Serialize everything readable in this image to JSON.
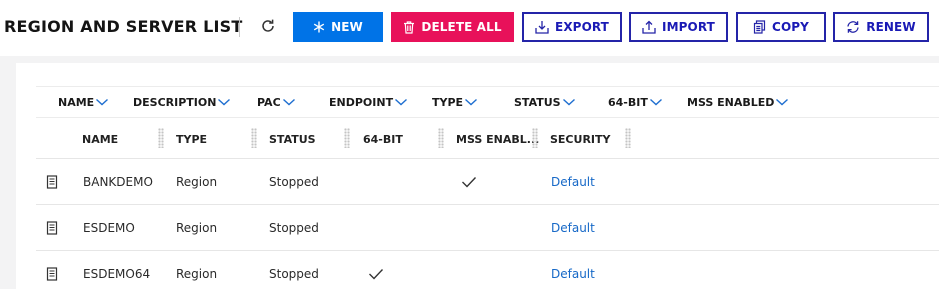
{
  "header": {
    "title": "REGION AND SERVER LIST",
    "buttons": {
      "new": "NEW",
      "delete_all": "DELETE ALL",
      "export": "EXPORT",
      "import": "IMPORT",
      "copy": "COPY",
      "renew": "RENEW"
    }
  },
  "filters": [
    "NAME",
    "DESCRIPTION",
    "PAC",
    "ENDPOINT",
    "TYPE",
    "STATUS",
    "64-BIT",
    "MSS ENABLED"
  ],
  "columns": [
    "NAME",
    "TYPE",
    "STATUS",
    "64-BIT",
    "MSS ENABL...",
    "SECURITY"
  ],
  "rows": [
    {
      "name": "BANKDEMO",
      "type": "Region",
      "status": "Stopped",
      "bit64": false,
      "mss_enabled": true,
      "security": "Default"
    },
    {
      "name": "ESDEMO",
      "type": "Region",
      "status": "Stopped",
      "bit64": false,
      "mss_enabled": false,
      "security": "Default"
    },
    {
      "name": "ESDEMO64",
      "type": "Region",
      "status": "Stopped",
      "bit64": true,
      "mss_enabled": false,
      "security": "Default"
    }
  ],
  "colors": {
    "primary": "#0073e7",
    "danger": "#e8115a",
    "outline": "#2424a8",
    "link": "#1668c7"
  },
  "icons": {
    "refresh": "refresh-icon",
    "new": "asterisk-icon",
    "delete_all": "trash-icon",
    "export": "export-icon",
    "import": "import-icon",
    "copy": "copy-icon",
    "renew": "renew-icon",
    "filter": "chevron-down-icon",
    "row": "document-icon",
    "check": "check-icon"
  }
}
